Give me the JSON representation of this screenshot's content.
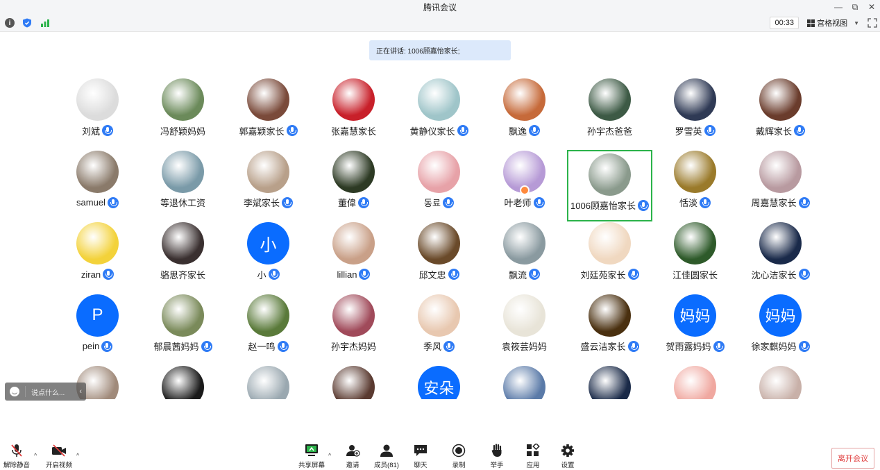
{
  "app": {
    "title": "腾讯会议"
  },
  "window_controls": {
    "minimize": "—",
    "restore": "⧉",
    "close": "✕"
  },
  "infobar": {
    "timer": "00:33",
    "view_label": "宫格视图",
    "view_caret": "▼"
  },
  "speaker_banner": "正在讲话: 1006顾嘉怡家长;",
  "colors": {
    "accent": "#0a6cff",
    "active_border": "#2bb34a",
    "leave_text": "#e03c3c",
    "banner_bg": "#dce9fb"
  },
  "participants": [
    {
      "name": "刘斌",
      "mic": true,
      "avatar_color": "#dcdcdc"
    },
    {
      "name": "冯舒颖妈妈",
      "mic": false,
      "avatar_color": "#6b8a5a"
    },
    {
      "name": "郭嘉颖家长",
      "mic": true,
      "avatar_color": "#7a4a3a"
    },
    {
      "name": "张嘉慧家长",
      "mic": false,
      "avatar_color": "#c8202a"
    },
    {
      "name": "黄静仪家长",
      "mic": true,
      "avatar_color": "#9fc5c9"
    },
    {
      "name": "飘逸",
      "mic": true,
      "avatar_color": "#c66a3a"
    },
    {
      "name": "孙宇杰爸爸",
      "mic": false,
      "avatar_color": "#3d5a45"
    },
    {
      "name": "罗雪英",
      "mic": true,
      "avatar_color": "#2f3a55"
    },
    {
      "name": "戴辉家长",
      "mic": true,
      "avatar_color": "#6a3c2c"
    },
    {
      "name": "samuel",
      "mic": true,
      "avatar_color": "#8a7a6a"
    },
    {
      "name": "等退休工资",
      "mic": false,
      "avatar_color": "#7a9aa8"
    },
    {
      "name": "李斌家长",
      "mic": true,
      "avatar_color": "#b8a08a"
    },
    {
      "name": "董偉",
      "mic": true,
      "avatar_color": "#2d3a24"
    },
    {
      "name": "동료",
      "mic": true,
      "avatar_color": "#e7a2a8"
    },
    {
      "name": "叶老师",
      "mic": true,
      "avatar_color": "#b69ad6",
      "host": true
    },
    {
      "name": "1006顾嘉怡家长",
      "mic": true,
      "avatar_color": "#8a9a8c",
      "active": true
    },
    {
      "name": "恬淡",
      "mic": true,
      "avatar_color": "#9a7a2a"
    },
    {
      "name": "周嘉慧家长",
      "mic": true,
      "avatar_color": "#b89aa0"
    },
    {
      "name": "ziran",
      "mic": true,
      "avatar_color": "#f3d23a"
    },
    {
      "name": "骆思齐家长",
      "mic": false,
      "avatar_color": "#3a3030"
    },
    {
      "name": "小",
      "mic": true,
      "avatar_text": "小"
    },
    {
      "name": "lillian",
      "mic": true,
      "avatar_color": "#c9a088"
    },
    {
      "name": "邱文忠",
      "mic": true,
      "avatar_color": "#6a4a2a"
    },
    {
      "name": "飘流",
      "mic": true,
      "avatar_color": "#8a9aa0"
    },
    {
      "name": "刘廷苑家长",
      "mic": true,
      "avatar_color": "#f0d8c0"
    },
    {
      "name": "江佳圆家长",
      "mic": false,
      "avatar_color": "#2e5a2a"
    },
    {
      "name": "沈心洁家长",
      "mic": true,
      "avatar_color": "#1a2a4a"
    },
    {
      "name": "pein",
      "mic": true,
      "avatar_text": "P"
    },
    {
      "name": "郁晨茜妈妈",
      "mic": true,
      "avatar_color": "#7a8a5a"
    },
    {
      "name": "赵一鸣",
      "mic": true,
      "avatar_color": "#5a7a3a"
    },
    {
      "name": "孙宇杰妈妈",
      "mic": false,
      "avatar_color": "#a04a5a"
    },
    {
      "name": "季风",
      "mic": true,
      "avatar_color": "#e8c8b0"
    },
    {
      "name": "袁筱芸妈妈",
      "mic": false,
      "avatar_color": "#e8e4d8"
    },
    {
      "name": "盛云洁家长",
      "mic": true,
      "avatar_color": "#4a3010"
    },
    {
      "name": "贺雨露妈妈",
      "mic": true,
      "avatar_text": "妈妈"
    },
    {
      "name": "徐家麒妈妈",
      "mic": true,
      "avatar_text": "妈妈"
    },
    {
      "name": "",
      "mic": false,
      "avatar_color": "#a08a7a"
    },
    {
      "name": "",
      "mic": false,
      "avatar_color": "#1a1a1a"
    },
    {
      "name": "",
      "mic": false,
      "avatar_color": "#9aa8b0"
    },
    {
      "name": "",
      "mic": false,
      "avatar_color": "#5a3a30"
    },
    {
      "name": "",
      "mic": false,
      "avatar_text": "安朵"
    },
    {
      "name": "",
      "mic": false,
      "avatar_color": "#5a7aa8"
    },
    {
      "name": "",
      "mic": false,
      "avatar_color": "#1a2a48"
    },
    {
      "name": "",
      "mic": false,
      "avatar_color": "#f0a8a0"
    },
    {
      "name": "",
      "mic": false,
      "avatar_color": "#c8b0a8"
    }
  ],
  "chat": {
    "placeholder": "说点什么...",
    "collapse": "‹"
  },
  "toolbar": {
    "unmute": "解除静音",
    "start_video": "开启视频",
    "share_screen": "共享屏幕",
    "invite": "邀请",
    "members": "成员(81)",
    "chat": "聊天",
    "record": "录制",
    "raise_hand": "举手",
    "apps": "应用",
    "settings": "设置",
    "caret": "^",
    "leave": "离开会议"
  }
}
